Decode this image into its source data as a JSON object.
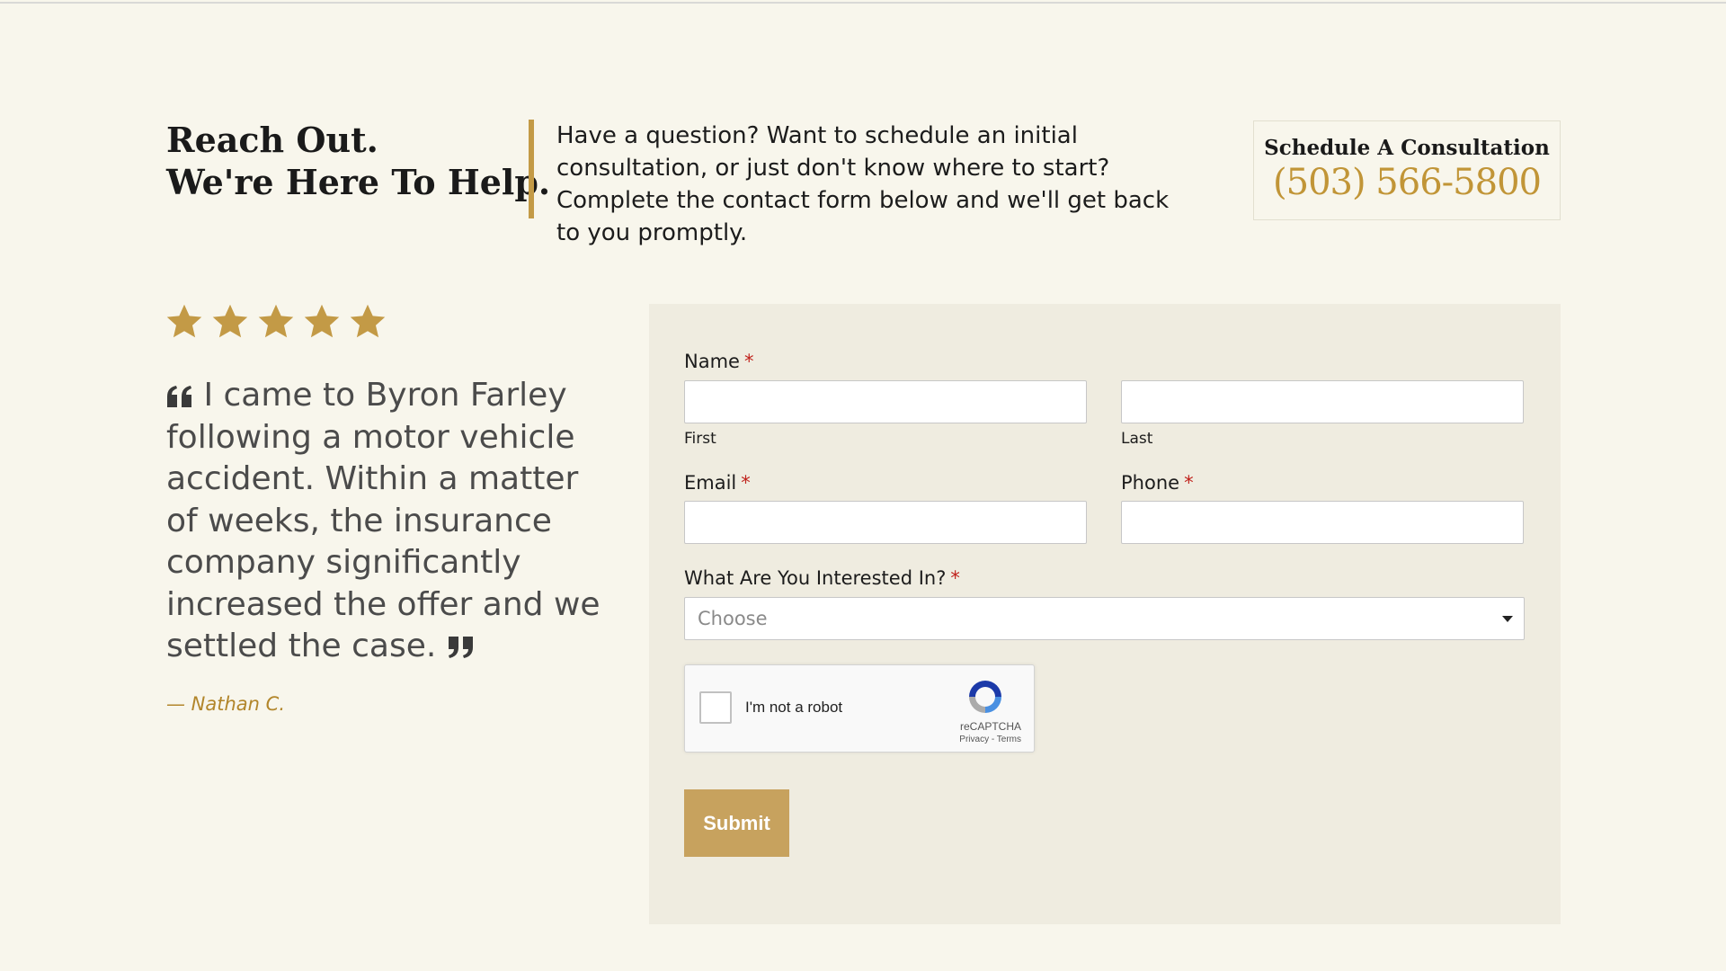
{
  "header": {
    "heading_line1": "Reach Out.",
    "heading_line2": "We're Here To Help.",
    "intro": "Have a question? Want to schedule an initial consultation, or just don't know where to start? Complete the contact form below and we'll get back to you promptly.",
    "consult_label": "Schedule A Consultation",
    "consult_phone": "(503) 566-5800"
  },
  "testimonial": {
    "rating": 5,
    "icon": "star-icon",
    "quote": "I came to Byron Farley following a motor vehicle accident. Within a matter of weeks, the insurance company significantly increased the offer and we settled the case.",
    "author": "— Nathan C."
  },
  "form": {
    "name_label": "Name",
    "required_mark": "*",
    "first_sublabel": "First",
    "last_sublabel": "Last",
    "email_label": "Email",
    "phone_label": "Phone",
    "interest_label": "What Are You Interested In?",
    "interest_placeholder": "Choose",
    "captcha_label": "I'm not a robot",
    "captcha_brand": "reCAPTCHA",
    "captcha_links": "Privacy - Terms",
    "submit_label": "Submit"
  },
  "colors": {
    "accent": "#c39a46",
    "phone": "#c19537",
    "button": "#c7a25e",
    "background": "#f8f6ec",
    "panel": "#efece0",
    "required": "#c0221c"
  }
}
